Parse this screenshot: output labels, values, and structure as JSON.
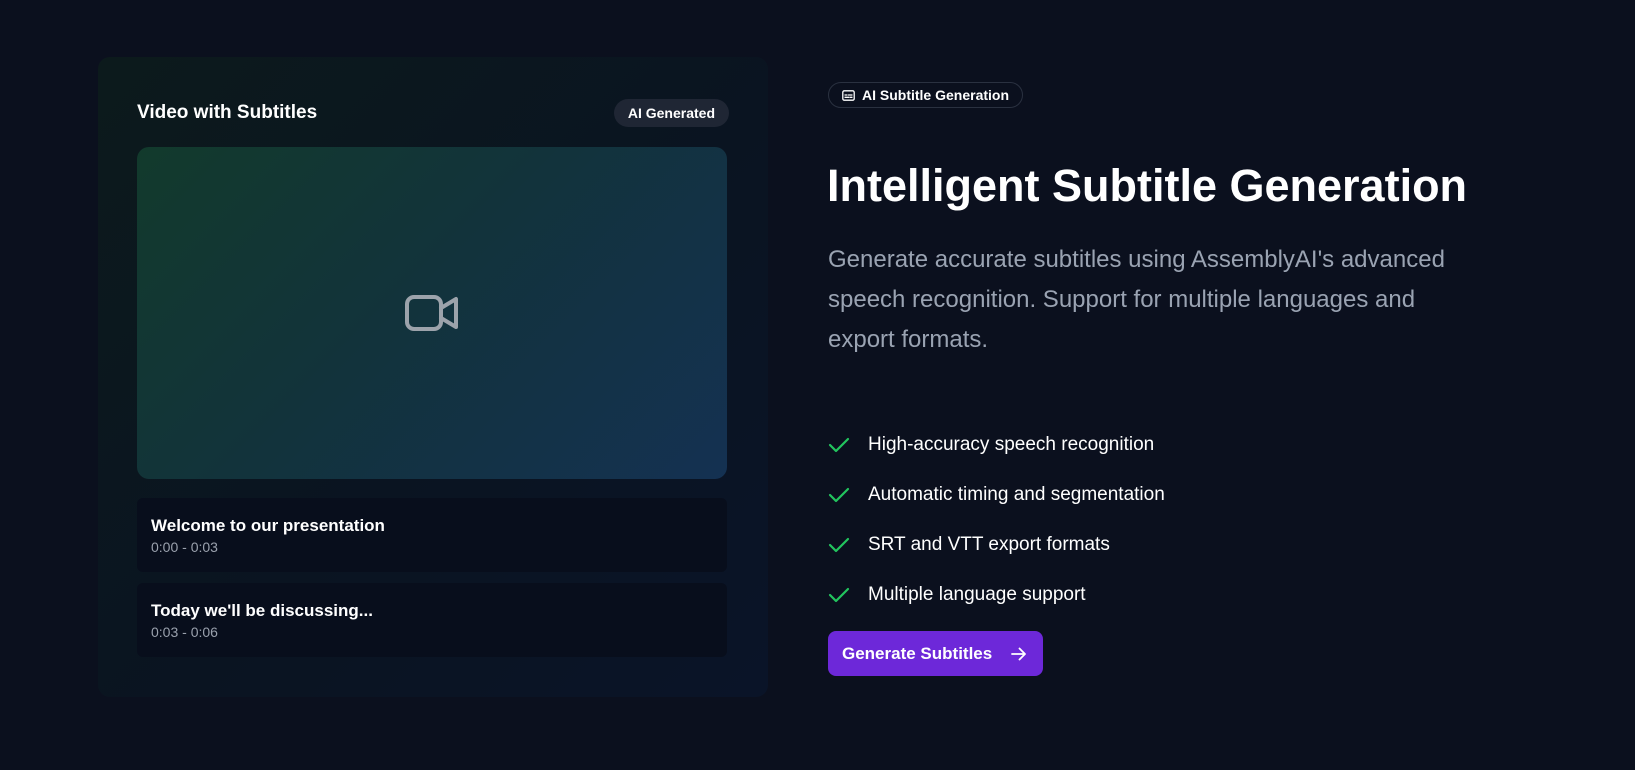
{
  "preview": {
    "title": "Video with Subtitles",
    "badge": "AI Generated",
    "video_icon": "video-camera-icon",
    "subtitles": [
      {
        "text": "Welcome to our presentation",
        "time": "0:00 - 0:03"
      },
      {
        "text": "Today we'll be discussing...",
        "time": "0:03 - 0:06"
      }
    ]
  },
  "hero": {
    "tag_icon": "subtitles-icon",
    "tag_label": "AI Subtitle Generation",
    "headline": "Intelligent Subtitle Generation",
    "description": "Generate accurate subtitles using AssemblyAI's advanced speech recognition. Support for multiple languages and export formats.",
    "features": [
      "High-accuracy speech recognition",
      "Automatic timing and segmentation",
      "SRT and VTT export formats",
      "Multiple language support"
    ],
    "feature_icon": "check-icon",
    "cta_label": "Generate Subtitles",
    "cta_icon": "arrow-right-icon"
  },
  "colors": {
    "background": "#0b101e",
    "accent": "#6d28d9",
    "check": "#22c55e",
    "muted_text": "#9aa3b2"
  }
}
